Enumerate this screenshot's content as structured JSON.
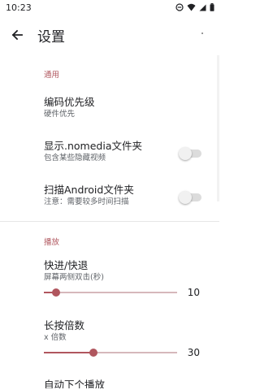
{
  "status_bar": {
    "time": "10:23"
  },
  "app_bar": {
    "title": "设置"
  },
  "sections": {
    "general": {
      "header": "通用",
      "decode": {
        "title": "编码优先级",
        "summary": "硬件优先"
      },
      "nomedia": {
        "title": "显示.nomedia文件夹",
        "summary": "包含某些隐藏视频",
        "enabled": false
      },
      "android_folder": {
        "title": "扫描Android文件夹",
        "summary": "注意：需要较多时间扫描",
        "enabled": false
      }
    },
    "playback": {
      "header": "播放",
      "seek": {
        "title": "快进/快退",
        "summary": "屏幕两侧双击(秒)",
        "value": "10",
        "fraction": 0.09
      },
      "long_press": {
        "title": "长按倍数",
        "summary": "x 倍数",
        "value": "30",
        "fraction": 0.37
      },
      "next_item_partial": {
        "title": "自动下个播放"
      }
    }
  },
  "colors": {
    "accent": "#b0565e",
    "switch_off_track": "#dcdcdc",
    "switch_off_thumb": "#f1f1f1"
  }
}
